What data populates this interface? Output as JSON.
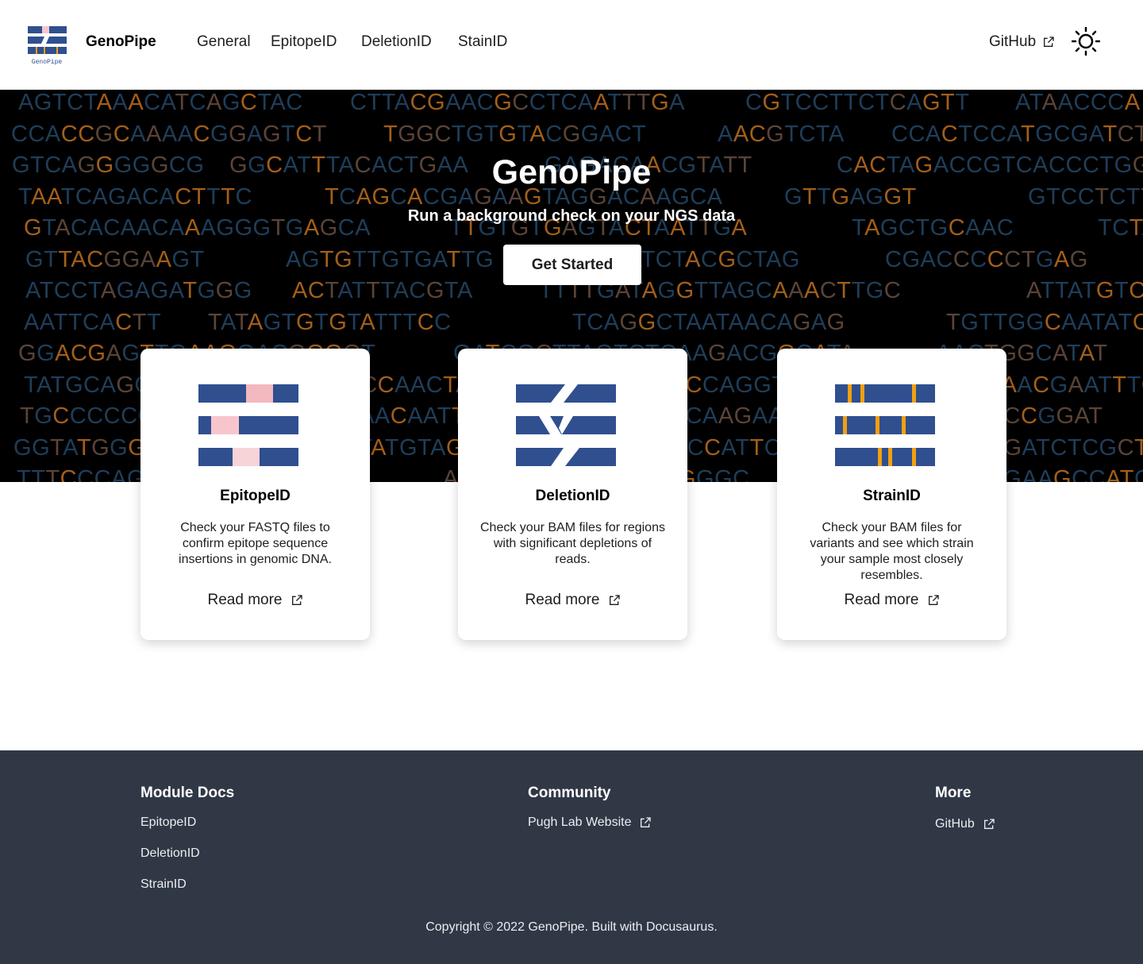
{
  "navbar": {
    "brand": "GenoPipe",
    "logo_caption": "GenoPipe",
    "links": [
      "General",
      "EpitopeID",
      "DeletionID",
      "StainID"
    ],
    "github": "GitHub",
    "icons": {
      "external": "external-link-icon",
      "theme": "sun-icon"
    }
  },
  "hero": {
    "title": "GenoPipe",
    "subtitle": "Run a background check on your NGS data",
    "button": "Get Started",
    "colors": {
      "background": "#000000",
      "blue": "#1f3e5a",
      "orange": "#a35f1a",
      "brown": "#5a4437"
    }
  },
  "cards": [
    {
      "title": "EpitopeID",
      "description": "Check your FASTQ files to confirm epitope sequence insertions in genomic DNA.",
      "link": "Read more",
      "icon": "epitope-icon"
    },
    {
      "title": "DeletionID",
      "description": "Check your BAM files for regions with significant depletions of reads.",
      "link": "Read more",
      "icon": "deletion-icon"
    },
    {
      "title": "StrainID",
      "description": "Check your BAM files for variants and see which strain your sample most closely resembles.",
      "link": "Read more",
      "icon": "strain-icon"
    }
  ],
  "footer": {
    "columns": [
      {
        "title": "Module Docs",
        "links": [
          "EpitopeID",
          "DeletionID",
          "StrainID"
        ]
      },
      {
        "title": "Community",
        "links": [
          "Pugh Lab Website"
        ]
      },
      {
        "title": "More",
        "links": [
          "GitHub"
        ]
      }
    ],
    "copyright": "Copyright © 2022 GenoPipe. Built with Docusaurus.",
    "colors": {
      "background": "#303846"
    }
  },
  "colors": {
    "icon_blue": "#2f4f8f",
    "icon_pink": "#f7c6cc",
    "icon_orange": "#f2a010"
  }
}
